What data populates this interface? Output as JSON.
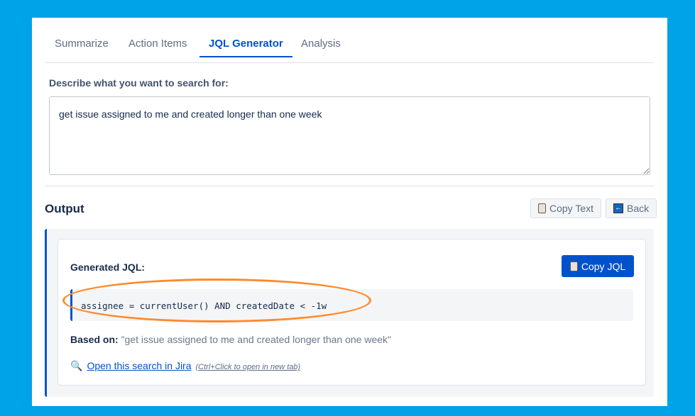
{
  "tabs": [
    {
      "label": "Summarize"
    },
    {
      "label": "Action Items"
    },
    {
      "label": "JQL Generator"
    },
    {
      "label": "Analysis"
    }
  ],
  "prompt": {
    "label": "Describe what you want to search for:",
    "value": "get issue assigned to me and created longer than one week"
  },
  "output": {
    "title": "Output",
    "copy_text": "Copy Text",
    "back": "Back",
    "generated_label": "Generated JQL:",
    "copy_jql": "Copy JQL",
    "jql": "assignee = currentUser() AND createdDate < -1w",
    "based_on_label": "Based on:",
    "based_on_value": "\"get issue assigned to me and created longer than one week\"",
    "link_text": "Open this search in Jira",
    "link_hint": "(Ctrl+Click to open in new tab)"
  },
  "colors": {
    "accent": "#0052cc",
    "background": "#00a2e8",
    "annotation": "#ff8a2a"
  }
}
